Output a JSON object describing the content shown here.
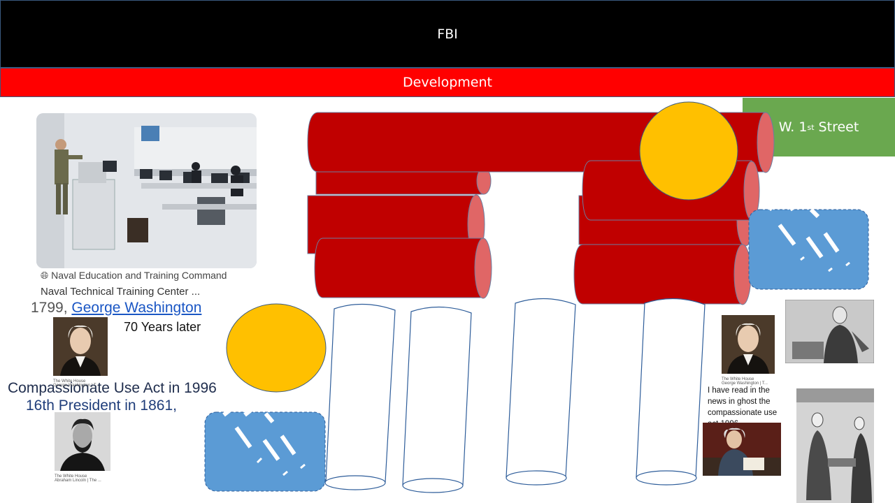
{
  "header": {
    "title": "FBI"
  },
  "subheader": {
    "title": "Development"
  },
  "street_sign": {
    "text": "W. 1",
    "suffix": "st",
    "tail": " Street",
    "color": "#6aa84f"
  },
  "photo_card": {
    "source": "Naval Education and Training Command",
    "title": "Naval Technical Training Center ..."
  },
  "texts": {
    "year_1799": "1799,",
    "washington_link": "George Washington",
    "seventy_years": "70 Years later",
    "compassionate": "Compassionate Use Act in 1996",
    "sixteenth": "16th President in 1861,",
    "read_news": "I have read in the news in ghost the compassionate use act 1996"
  },
  "thumbs": {
    "washington_left_source": "The White House",
    "washington_left_title": "George Washington | T...",
    "lincoln_source": "The White House",
    "lincoln_title": "Abraham Lincoln | The ...",
    "washington_right_source": "The White House",
    "washington_right_title": "George Washington | T..."
  },
  "colors": {
    "header_bg": "#000000",
    "subheader_bg": "#ff0000",
    "log_red": "#c00000",
    "log_end": "#e06666",
    "circle_yellow": "#ffc000",
    "cloud_blue": "#5b9bd5",
    "column_stroke": "#2e5d9a"
  }
}
